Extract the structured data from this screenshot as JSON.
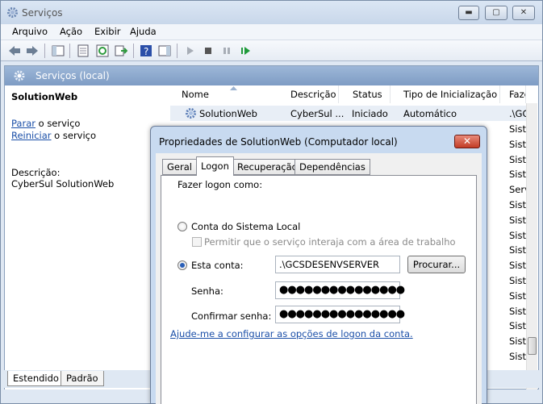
{
  "window": {
    "title": "Serviços",
    "minimize_label": "▬",
    "maximize_label": "▢",
    "close_label": "✕"
  },
  "menu": [
    "Arquivo",
    "Ação",
    "Exibir",
    "Ajuda"
  ],
  "panel": {
    "title": "Serviços (local)"
  },
  "left_pane": {
    "service_name": "SolutionWeb",
    "stop_link": "Parar",
    "stop_suffix": " o serviço",
    "restart_link": "Reiniciar",
    "restart_suffix": " o serviço",
    "description_label": "Descrição:",
    "description_value": "CyberSul SolutionWeb"
  },
  "list": {
    "columns": [
      "Nome",
      "Descrição",
      "Status",
      "Tipo de Inicialização",
      "Faze"
    ],
    "first_row": {
      "name": "SolutionWeb",
      "description": "CyberSul ...",
      "status": "Iniciado",
      "startup": "Automático",
      "logon": ".\\GC"
    },
    "logon_column": [
      "Siste",
      "Siste",
      "Siste",
      "Siste",
      "Serv",
      "Siste",
      "Siste",
      "Siste",
      "Siste",
      "Siste",
      "Siste",
      "Siste",
      "Siste",
      "Siste",
      "Siste",
      "Siste"
    ]
  },
  "bottom_tabs": [
    "Estendido",
    "Padrão"
  ],
  "dialog": {
    "title": "Propriedades de SolutionWeb (Computador local)",
    "close_label": "✕",
    "tabs": [
      "Geral",
      "Logon",
      "Recuperação",
      "Dependências"
    ],
    "logon_as_label": "Fazer logon como:",
    "local_system_label": "Conta do Sistema Local",
    "allow_desktop_label": "Permitir que o serviço interaja com a área de trabalho",
    "this_account_label": "Esta conta:",
    "account_value": ".\\GCSDESENVSERVER",
    "browse_label": "Procurar...",
    "password_label": "Senha:",
    "password_value": "●●●●●●●●●●●●●●●",
    "confirm_label": "Confirmar senha:",
    "confirm_value": "●●●●●●●●●●●●●●●",
    "help_link": "Ajude-me a configurar as opções de logon da conta."
  }
}
